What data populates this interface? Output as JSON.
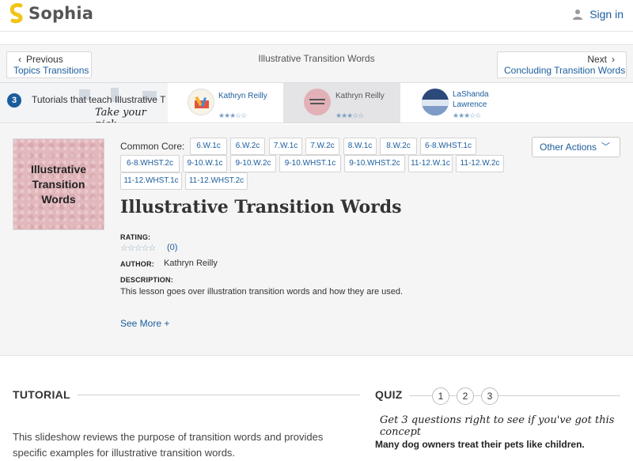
{
  "brand": {
    "name": "Sophia",
    "accent": "#1b5d9c",
    "logo_color": "#f0c419"
  },
  "header": {
    "signin_label": "Sign in",
    "signin_icon": "person-icon"
  },
  "nav": {
    "prev_small": "Previous",
    "prev_link": "Topics Transitions",
    "title": "Illustrative Transition Words",
    "next_small": "Next",
    "next_link": "Concluding Transition Words"
  },
  "tutorials": {
    "count": "3",
    "teach_label": "Tutorials that teach Illustrative T",
    "pick_label": "Take your pick:",
    "cards": [
      {
        "name": "Kathryn Reilly",
        "stars": "★★★☆☆"
      },
      {
        "name": "Kathryn Reilly",
        "stars": "★★★☆☆"
      },
      {
        "name": "LaShanda Lawrence",
        "stars": "★★★☆☆"
      }
    ]
  },
  "lesson": {
    "thumb_text": "Illustrative Transition Words",
    "common_core_label": "Common Core:",
    "standards": [
      "6.W.1c",
      "6.W.2c",
      "7.W.1c",
      "7.W.2c",
      "8.W.1c",
      "8.W.2c",
      "6-8.WHST.1c",
      "6-8.WHST.2c",
      "9-10.W.1c",
      "9-10.W.2c",
      "9-10.WHST.1c",
      "9-10.WHST.2c",
      "11-12.W.1c",
      "11-12.W.2c",
      "11-12.WHST.1c",
      "11-12.WHST.2c"
    ],
    "other_actions": "Other Actions",
    "title": "Illustrative Transition Words",
    "rating_label": "RATING:",
    "rating_stars": "☆☆☆☆☆",
    "rating_count": "(0)",
    "author_label": "AUTHOR:",
    "author": "Kathryn Reilly",
    "description_label": "DESCRIPTION:",
    "description": "This lesson goes over illustration transition words and how they are used.",
    "see_more": "See More +"
  },
  "tutorial_section": {
    "heading": "TUTORIAL",
    "text": "This slideshow reviews the purpose of transition words and provides specific examples for illustrative transition words."
  },
  "quiz": {
    "heading": "QUIZ",
    "numbers": [
      "1",
      "2",
      "3"
    ],
    "hint": "Get 3 questions right to see if you've got this concept",
    "question": "Many dog owners treat their pets like children."
  }
}
